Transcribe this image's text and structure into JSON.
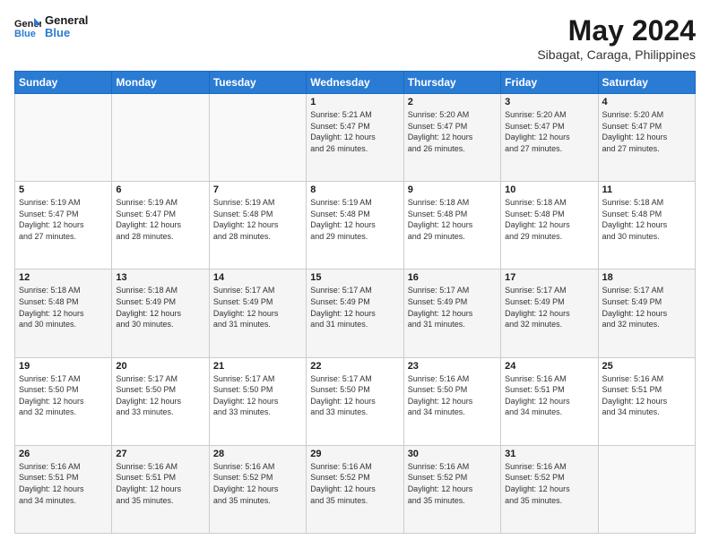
{
  "logo": {
    "line1": "General",
    "line2": "Blue"
  },
  "title": "May 2024",
  "location": "Sibagat, Caraga, Philippines",
  "weekdays": [
    "Sunday",
    "Monday",
    "Tuesday",
    "Wednesday",
    "Thursday",
    "Friday",
    "Saturday"
  ],
  "weeks": [
    [
      {
        "day": "",
        "info": ""
      },
      {
        "day": "",
        "info": ""
      },
      {
        "day": "",
        "info": ""
      },
      {
        "day": "1",
        "info": "Sunrise: 5:21 AM\nSunset: 5:47 PM\nDaylight: 12 hours\nand 26 minutes."
      },
      {
        "day": "2",
        "info": "Sunrise: 5:20 AM\nSunset: 5:47 PM\nDaylight: 12 hours\nand 26 minutes."
      },
      {
        "day": "3",
        "info": "Sunrise: 5:20 AM\nSunset: 5:47 PM\nDaylight: 12 hours\nand 27 minutes."
      },
      {
        "day": "4",
        "info": "Sunrise: 5:20 AM\nSunset: 5:47 PM\nDaylight: 12 hours\nand 27 minutes."
      }
    ],
    [
      {
        "day": "5",
        "info": "Sunrise: 5:19 AM\nSunset: 5:47 PM\nDaylight: 12 hours\nand 27 minutes."
      },
      {
        "day": "6",
        "info": "Sunrise: 5:19 AM\nSunset: 5:47 PM\nDaylight: 12 hours\nand 28 minutes."
      },
      {
        "day": "7",
        "info": "Sunrise: 5:19 AM\nSunset: 5:48 PM\nDaylight: 12 hours\nand 28 minutes."
      },
      {
        "day": "8",
        "info": "Sunrise: 5:19 AM\nSunset: 5:48 PM\nDaylight: 12 hours\nand 29 minutes."
      },
      {
        "day": "9",
        "info": "Sunrise: 5:18 AM\nSunset: 5:48 PM\nDaylight: 12 hours\nand 29 minutes."
      },
      {
        "day": "10",
        "info": "Sunrise: 5:18 AM\nSunset: 5:48 PM\nDaylight: 12 hours\nand 29 minutes."
      },
      {
        "day": "11",
        "info": "Sunrise: 5:18 AM\nSunset: 5:48 PM\nDaylight: 12 hours\nand 30 minutes."
      }
    ],
    [
      {
        "day": "12",
        "info": "Sunrise: 5:18 AM\nSunset: 5:48 PM\nDaylight: 12 hours\nand 30 minutes."
      },
      {
        "day": "13",
        "info": "Sunrise: 5:18 AM\nSunset: 5:49 PM\nDaylight: 12 hours\nand 30 minutes."
      },
      {
        "day": "14",
        "info": "Sunrise: 5:17 AM\nSunset: 5:49 PM\nDaylight: 12 hours\nand 31 minutes."
      },
      {
        "day": "15",
        "info": "Sunrise: 5:17 AM\nSunset: 5:49 PM\nDaylight: 12 hours\nand 31 minutes."
      },
      {
        "day": "16",
        "info": "Sunrise: 5:17 AM\nSunset: 5:49 PM\nDaylight: 12 hours\nand 31 minutes."
      },
      {
        "day": "17",
        "info": "Sunrise: 5:17 AM\nSunset: 5:49 PM\nDaylight: 12 hours\nand 32 minutes."
      },
      {
        "day": "18",
        "info": "Sunrise: 5:17 AM\nSunset: 5:49 PM\nDaylight: 12 hours\nand 32 minutes."
      }
    ],
    [
      {
        "day": "19",
        "info": "Sunrise: 5:17 AM\nSunset: 5:50 PM\nDaylight: 12 hours\nand 32 minutes."
      },
      {
        "day": "20",
        "info": "Sunrise: 5:17 AM\nSunset: 5:50 PM\nDaylight: 12 hours\nand 33 minutes."
      },
      {
        "day": "21",
        "info": "Sunrise: 5:17 AM\nSunset: 5:50 PM\nDaylight: 12 hours\nand 33 minutes."
      },
      {
        "day": "22",
        "info": "Sunrise: 5:17 AM\nSunset: 5:50 PM\nDaylight: 12 hours\nand 33 minutes."
      },
      {
        "day": "23",
        "info": "Sunrise: 5:16 AM\nSunset: 5:50 PM\nDaylight: 12 hours\nand 34 minutes."
      },
      {
        "day": "24",
        "info": "Sunrise: 5:16 AM\nSunset: 5:51 PM\nDaylight: 12 hours\nand 34 minutes."
      },
      {
        "day": "25",
        "info": "Sunrise: 5:16 AM\nSunset: 5:51 PM\nDaylight: 12 hours\nand 34 minutes."
      }
    ],
    [
      {
        "day": "26",
        "info": "Sunrise: 5:16 AM\nSunset: 5:51 PM\nDaylight: 12 hours\nand 34 minutes."
      },
      {
        "day": "27",
        "info": "Sunrise: 5:16 AM\nSunset: 5:51 PM\nDaylight: 12 hours\nand 35 minutes."
      },
      {
        "day": "28",
        "info": "Sunrise: 5:16 AM\nSunset: 5:52 PM\nDaylight: 12 hours\nand 35 minutes."
      },
      {
        "day": "29",
        "info": "Sunrise: 5:16 AM\nSunset: 5:52 PM\nDaylight: 12 hours\nand 35 minutes."
      },
      {
        "day": "30",
        "info": "Sunrise: 5:16 AM\nSunset: 5:52 PM\nDaylight: 12 hours\nand 35 minutes."
      },
      {
        "day": "31",
        "info": "Sunrise: 5:16 AM\nSunset: 5:52 PM\nDaylight: 12 hours\nand 35 minutes."
      },
      {
        "day": "",
        "info": ""
      }
    ]
  ]
}
